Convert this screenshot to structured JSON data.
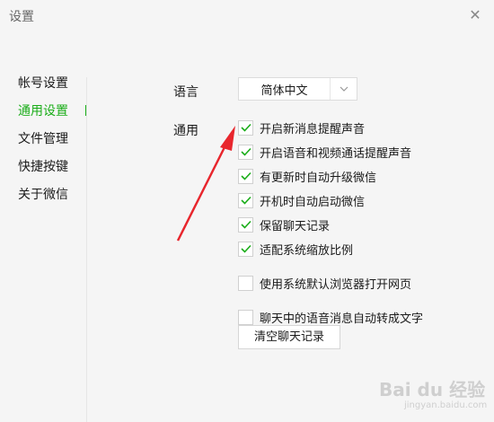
{
  "window": {
    "title": "设置",
    "close_glyph": "✕"
  },
  "sidebar": {
    "items": [
      {
        "label": "帐号设置",
        "active": false
      },
      {
        "label": "通用设置",
        "active": true
      },
      {
        "label": "文件管理",
        "active": false
      },
      {
        "label": "快捷按键",
        "active": false
      },
      {
        "label": "关于微信",
        "active": false
      }
    ]
  },
  "general": {
    "language_label": "语言",
    "language_value": "简体中文",
    "section_label": "通用",
    "options": [
      {
        "label": "开启新消息提醒声音",
        "checked": true
      },
      {
        "label": "开启语音和视频通话提醒声音",
        "checked": true
      },
      {
        "label": "有更新时自动升级微信",
        "checked": true
      },
      {
        "label": "开机时自动启动微信",
        "checked": true
      },
      {
        "label": "保留聊天记录",
        "checked": true
      },
      {
        "label": "适配系统缩放比例",
        "checked": true
      },
      {
        "label": "使用系统默认浏览器打开网页",
        "checked": false
      },
      {
        "label": "聊天中的语音消息自动转成文字",
        "checked": false
      }
    ],
    "clear_button": "清空聊天记录"
  },
  "colors": {
    "accent": "#1aad19",
    "annotation_arrow": "#e8262d"
  },
  "watermark": {
    "text": "Bai du 经验",
    "url": "jingyan.baidu.com"
  }
}
